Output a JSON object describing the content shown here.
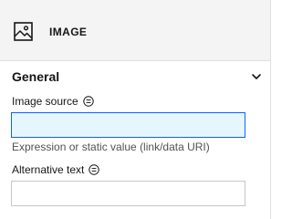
{
  "header": {
    "icon": "image-icon",
    "title": "IMAGE"
  },
  "section": {
    "title": "General",
    "expanded": true,
    "chevron_icon": "chevron-down-icon"
  },
  "fields": {
    "image_source": {
      "label": "Image source",
      "info_icon": "info-icon",
      "value": "",
      "placeholder": "",
      "helper": "Expression or static value (link/data URI)",
      "focused": true
    },
    "alt_text": {
      "label": "Alternative text",
      "info_icon": "info-icon",
      "value": "",
      "placeholder": ""
    }
  },
  "colors": {
    "header_bg": "#f4f4f4",
    "focus_border": "#0f62fe",
    "focus_bg": "#e5f6ff",
    "input_border": "#c6c6c6",
    "helper_text": "#525252"
  }
}
